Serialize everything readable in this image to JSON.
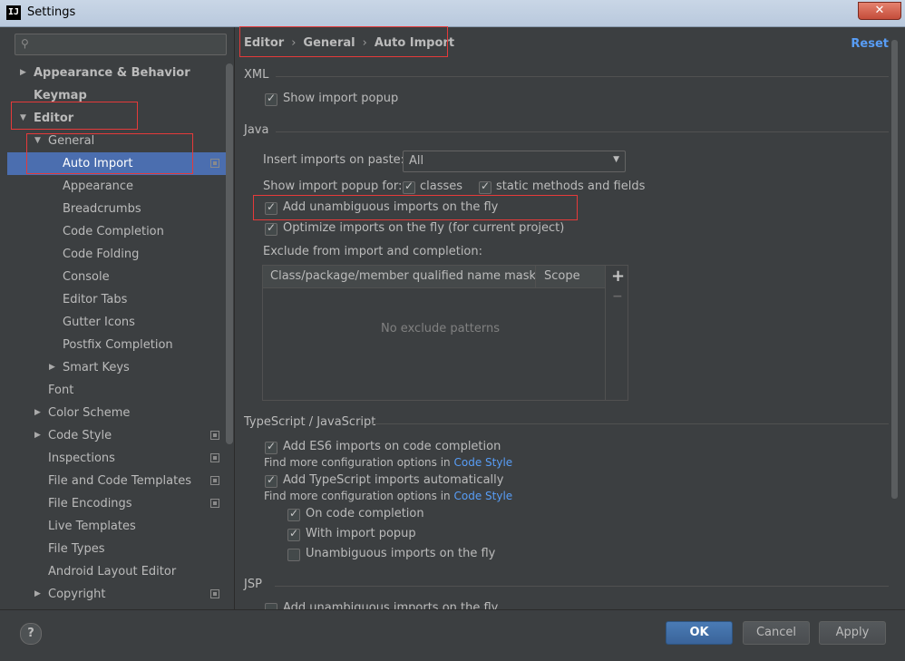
{
  "window": {
    "title": "Settings",
    "app_icon": "IJ",
    "close": "✕"
  },
  "search": {
    "placeholder": ""
  },
  "sidebar": {
    "items": [
      {
        "label": "Appearance & Behavior",
        "arrow": "▶"
      },
      {
        "label": "Keymap"
      },
      {
        "label": "Editor",
        "arrow": "▼"
      },
      {
        "label": "General",
        "arrow": "▼"
      },
      {
        "label": "Auto Import"
      },
      {
        "label": "Appearance"
      },
      {
        "label": "Breadcrumbs"
      },
      {
        "label": "Code Completion"
      },
      {
        "label": "Code Folding"
      },
      {
        "label": "Console"
      },
      {
        "label": "Editor Tabs"
      },
      {
        "label": "Gutter Icons"
      },
      {
        "label": "Postfix Completion"
      },
      {
        "label": "Smart Keys",
        "arrow": "▶"
      },
      {
        "label": "Font"
      },
      {
        "label": "Color Scheme",
        "arrow": "▶"
      },
      {
        "label": "Code Style",
        "arrow": "▶"
      },
      {
        "label": "Inspections"
      },
      {
        "label": "File and Code Templates"
      },
      {
        "label": "File Encodings"
      },
      {
        "label": "Live Templates"
      },
      {
        "label": "File Types"
      },
      {
        "label": "Android Layout Editor"
      },
      {
        "label": "Copyright",
        "arrow": "▶"
      }
    ]
  },
  "breadcrumb": {
    "items": [
      "Editor",
      "General",
      "Auto Import"
    ],
    "sep": "›"
  },
  "reset_label": "Reset",
  "xml": {
    "title": "XML",
    "show_import_popup": "Show import popup"
  },
  "java": {
    "title": "Java",
    "insert_imports_label": "Insert imports on paste:",
    "insert_imports_value": "All",
    "show_popup_for": "Show import popup for:",
    "classes": "classes",
    "static_methods": "static methods and fields",
    "add_unambiguous": "Add unambiguous imports on the fly",
    "optimize_imports": "Optimize imports on the fly (for current project)",
    "exclude_label": "Exclude from import and completion:",
    "table_col1": "Class/package/member qualified name mask",
    "table_col2": "Scope",
    "table_empty": "No exclude patterns",
    "plus": "+",
    "minus": "−"
  },
  "ts": {
    "title": "TypeScript / JavaScript",
    "add_es6": "Add ES6 imports on code completion",
    "find_more_1": "Find more configuration options in",
    "code_style_link_1": "Code Style",
    "add_ts": "Add TypeScript imports automatically",
    "find_more_2": "Find more configuration options in",
    "code_style_link_2": "Code Style",
    "on_code_completion": "On code completion",
    "with_import_popup": "With import popup",
    "unambiguous_fly": "Unambiguous imports on the fly"
  },
  "jsp": {
    "title": "JSP",
    "add_unambiguous": "Add unambiguous imports on the fly"
  },
  "footer": {
    "help": "?",
    "ok": "OK",
    "cancel": "Cancel",
    "apply": "Apply"
  }
}
